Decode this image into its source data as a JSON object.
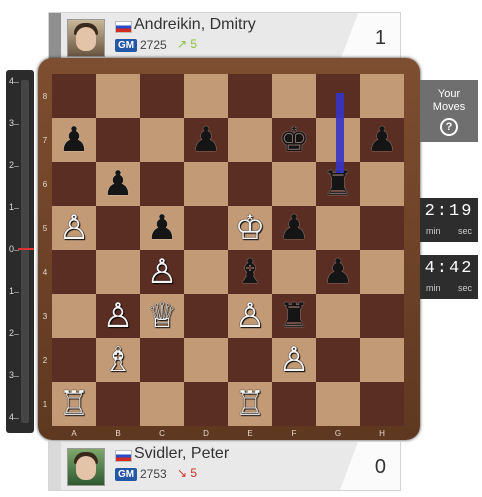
{
  "top_player": {
    "name": "Andreikin, Dmitry",
    "title": "GM",
    "rating": "2725",
    "delta": "5",
    "score": "1"
  },
  "bottom_player": {
    "name": "Svidler, Peter",
    "title": "GM",
    "rating": "2753",
    "delta": "5",
    "score": "0"
  },
  "eval_labels": [
    "4",
    "3",
    "2",
    "1",
    "0",
    "1",
    "2",
    "3",
    "4"
  ],
  "ranks": [
    "8",
    "7",
    "6",
    "5",
    "4",
    "3",
    "2",
    "1"
  ],
  "files": [
    "A",
    "B",
    "C",
    "D",
    "E",
    "F",
    "G",
    "H"
  ],
  "moves_button": {
    "line1": "Your",
    "line2": "Moves",
    "icon": "?"
  },
  "clock_top": {
    "time": "2:19",
    "min": "min",
    "sec": "sec"
  },
  "clock_bottom": {
    "time": "4:42",
    "min": "min",
    "sec": "sec"
  },
  "pieces": [
    {
      "sq": "a7",
      "glyph": "♟",
      "color": "b",
      "name": "black-pawn"
    },
    {
      "sq": "d7",
      "glyph": "♟",
      "color": "b",
      "name": "black-pawn"
    },
    {
      "sq": "f7",
      "glyph": "♚",
      "color": "b",
      "name": "black-king"
    },
    {
      "sq": "h7",
      "glyph": "♟",
      "color": "b",
      "name": "black-pawn"
    },
    {
      "sq": "b6",
      "glyph": "♟",
      "color": "b",
      "name": "black-pawn"
    },
    {
      "sq": "g6",
      "glyph": "♜",
      "color": "b",
      "name": "black-rook"
    },
    {
      "sq": "a5",
      "glyph": "♙",
      "color": "w",
      "name": "white-pawn"
    },
    {
      "sq": "c5",
      "glyph": "♟",
      "color": "b",
      "name": "black-pawn"
    },
    {
      "sq": "e5",
      "glyph": "♔",
      "color": "w",
      "name": "white-king"
    },
    {
      "sq": "f5",
      "glyph": "♟",
      "color": "b",
      "name": "black-pawn"
    },
    {
      "sq": "c4",
      "glyph": "♙",
      "color": "w",
      "name": "white-pawn"
    },
    {
      "sq": "e4",
      "glyph": "♝",
      "color": "b",
      "name": "black-bishop"
    },
    {
      "sq": "g4",
      "glyph": "♟",
      "color": "b",
      "name": "black-pawn"
    },
    {
      "sq": "b3",
      "glyph": "♙",
      "color": "w",
      "name": "white-pawn"
    },
    {
      "sq": "c3",
      "glyph": "♕",
      "color": "w",
      "name": "white-queen"
    },
    {
      "sq": "e3",
      "glyph": "♙",
      "color": "w",
      "name": "white-pawn"
    },
    {
      "sq": "f3",
      "glyph": "♜",
      "color": "b",
      "name": "black-rook"
    },
    {
      "sq": "b2",
      "glyph": "♗",
      "color": "w",
      "name": "white-bishop"
    },
    {
      "sq": "f2",
      "glyph": "♙",
      "color": "w",
      "name": "white-pawn"
    },
    {
      "sq": "a1",
      "glyph": "♖",
      "color": "w",
      "name": "white-rook"
    },
    {
      "sq": "e1",
      "glyph": "♖",
      "color": "w",
      "name": "white-rook"
    }
  ]
}
